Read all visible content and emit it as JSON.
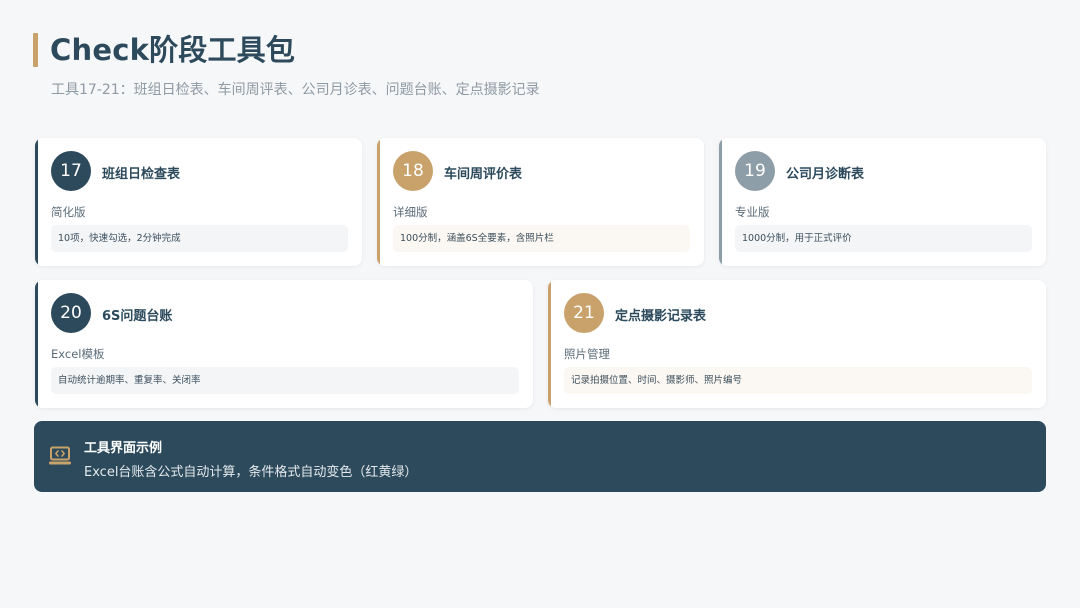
{
  "header": {
    "title": "Check阶段工具包",
    "subtitle": "工具17-21：班组日检表、车间周评表、公司月诊表、问题台账、定点摄影记录"
  },
  "tools": [
    {
      "number": "17",
      "title": "班组日检查表",
      "version": "简化版",
      "description": "10项，快速勾选，2分钟完成"
    },
    {
      "number": "18",
      "title": "车间周评价表",
      "version": "详细版",
      "description": "100分制，涵盖6S全要素，含照片栏"
    },
    {
      "number": "19",
      "title": "公司月诊断表",
      "version": "专业版",
      "description": "1000分制，用于正式评价"
    },
    {
      "number": "20",
      "title": "6S问题台账",
      "version": "Excel模板",
      "description": "自动统计逾期率、重复率、关闭率"
    },
    {
      "number": "21",
      "title": "定点摄影记录表",
      "version": "照片管理",
      "description": "记录拍摄位置、时间、摄影师、照片编号"
    }
  ],
  "banner": {
    "icon": "laptop-code-icon",
    "title": "工具界面示例",
    "text": "Excel台账含公式自动计算，条件格式自动变色（红黄绿）"
  },
  "colors": {
    "navy": "#2c4a5c",
    "gold": "#c9a26b",
    "gray": "#8e9ea8",
    "background": "#f6f7f9"
  }
}
